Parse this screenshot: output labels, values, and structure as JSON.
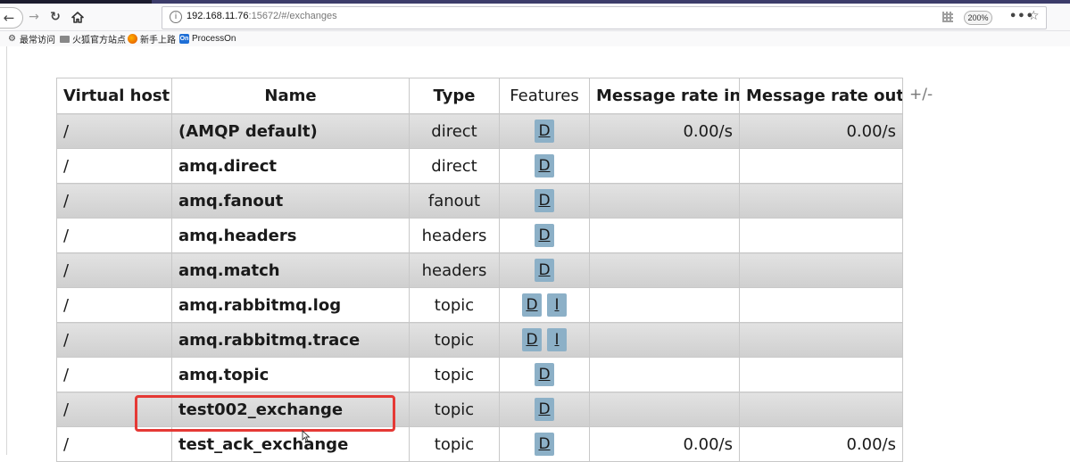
{
  "browser": {
    "url_host": "192.168.11.76",
    "url_rest": ":15672/#/exchanges",
    "zoom": "200%",
    "bookmarks": [
      {
        "label": "最常访问",
        "icon": "gear-icon"
      },
      {
        "label": "火狐官方站点",
        "icon": "folder-icon"
      },
      {
        "label": "新手上路",
        "icon": "firefox-icon"
      },
      {
        "label": "ProcessOn",
        "icon": "processon-icon"
      }
    ]
  },
  "table": {
    "headers": {
      "virtual_host": "Virtual host",
      "name": "Name",
      "type": "Type",
      "features": "Features",
      "rate_in": "Message rate in",
      "rate_out": "Message rate out"
    },
    "toggle_columns": "+/-",
    "rows": [
      {
        "vhost": "/",
        "name": "(AMQP default)",
        "type": "direct",
        "features": [
          "D"
        ],
        "rate_in": "0.00/s",
        "rate_out": "0.00/s"
      },
      {
        "vhost": "/",
        "name": "amq.direct",
        "type": "direct",
        "features": [
          "D"
        ],
        "rate_in": "",
        "rate_out": ""
      },
      {
        "vhost": "/",
        "name": "amq.fanout",
        "type": "fanout",
        "features": [
          "D"
        ],
        "rate_in": "",
        "rate_out": ""
      },
      {
        "vhost": "/",
        "name": "amq.headers",
        "type": "headers",
        "features": [
          "D"
        ],
        "rate_in": "",
        "rate_out": ""
      },
      {
        "vhost": "/",
        "name": "amq.match",
        "type": "headers",
        "features": [
          "D"
        ],
        "rate_in": "",
        "rate_out": ""
      },
      {
        "vhost": "/",
        "name": "amq.rabbitmq.log",
        "type": "topic",
        "features": [
          "D",
          "I"
        ],
        "rate_in": "",
        "rate_out": ""
      },
      {
        "vhost": "/",
        "name": "amq.rabbitmq.trace",
        "type": "topic",
        "features": [
          "D",
          "I"
        ],
        "rate_in": "",
        "rate_out": ""
      },
      {
        "vhost": "/",
        "name": "amq.topic",
        "type": "topic",
        "features": [
          "D"
        ],
        "rate_in": "",
        "rate_out": ""
      },
      {
        "vhost": "/",
        "name": "test002_exchange",
        "type": "topic",
        "features": [
          "D"
        ],
        "rate_in": "",
        "rate_out": ""
      },
      {
        "vhost": "/",
        "name": "test_ack_exchange",
        "type": "topic",
        "features": [
          "D"
        ],
        "rate_in": "0.00/s",
        "rate_out": "0.00/s"
      }
    ]
  },
  "colors": {
    "highlight_border": "#e53935",
    "feature_tag_bg": "#8cb0c7",
    "alt_row_bg": "#d9d9d9"
  }
}
